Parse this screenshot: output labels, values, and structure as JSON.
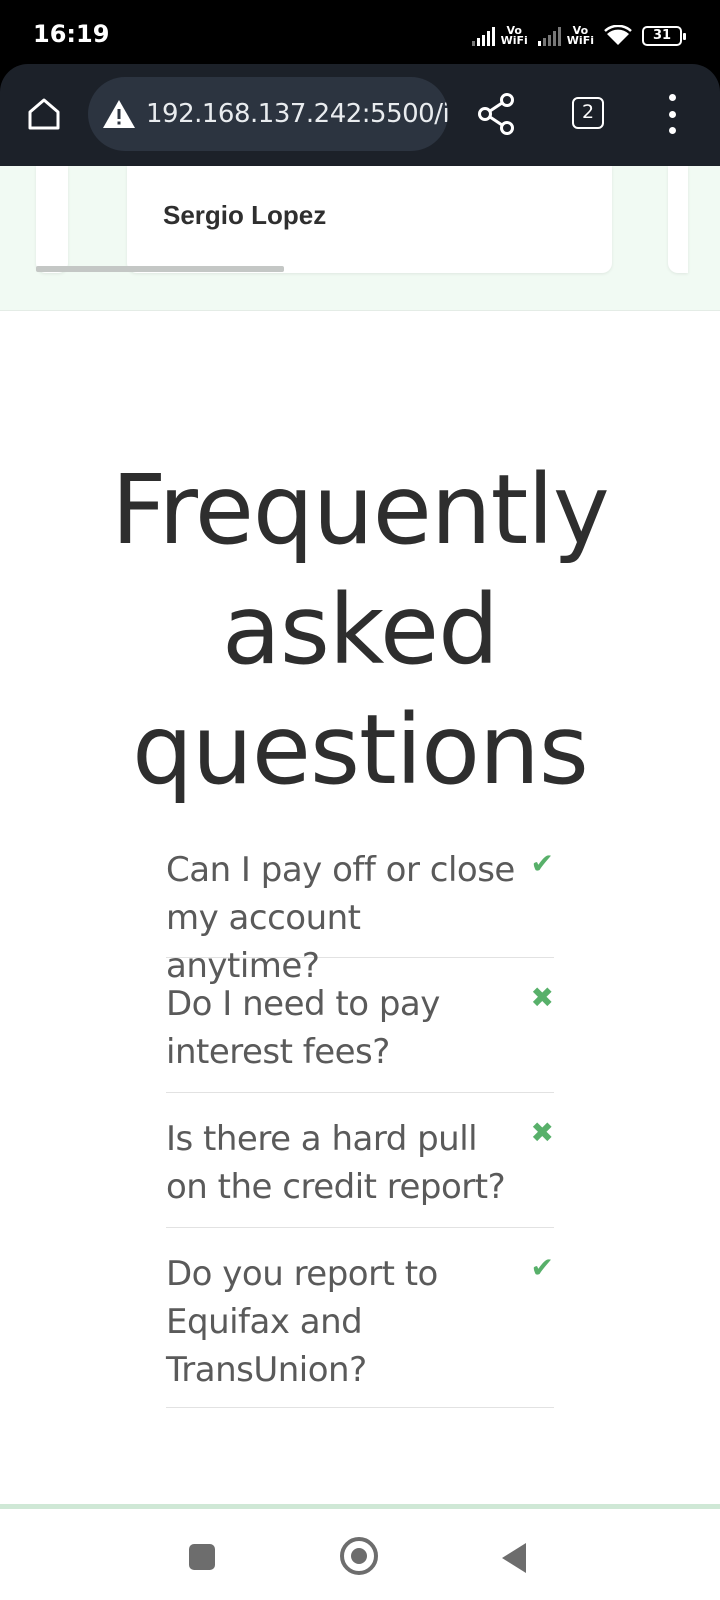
{
  "status_bar": {
    "time": "16:19",
    "vo_wifi_1": "Vo\nWiFi",
    "vo_wifi_2": "Vo\nWiFi",
    "battery": "31"
  },
  "browser": {
    "url": "192.168.137.242:5500/i",
    "tab_count": "2",
    "icons": [
      "home-icon",
      "warning-icon",
      "share-icon",
      "tabs-icon",
      "more-vertical-icon"
    ]
  },
  "testimonial": {
    "author": "Sergio Lopez"
  },
  "faq": {
    "title": "Frequently asked questions",
    "accent_color": "#58b06a",
    "items": [
      {
        "question": "Can I pay off or close my account anytime?",
        "mark": "✔",
        "mark_icon": "check-icon"
      },
      {
        "question": "Do I need to pay interest fees?",
        "mark": "✖",
        "mark_icon": "cross-icon"
      },
      {
        "question": "Is there a hard pull on the credit report?",
        "mark": "✖",
        "mark_icon": "cross-icon"
      },
      {
        "question": "Do you report to Equifax and TransUnion?",
        "mark": "✔",
        "mark_icon": "check-icon"
      }
    ]
  },
  "nav_bar": {
    "icons": [
      "recent-apps-icon",
      "home-circle-icon",
      "back-icon"
    ]
  }
}
